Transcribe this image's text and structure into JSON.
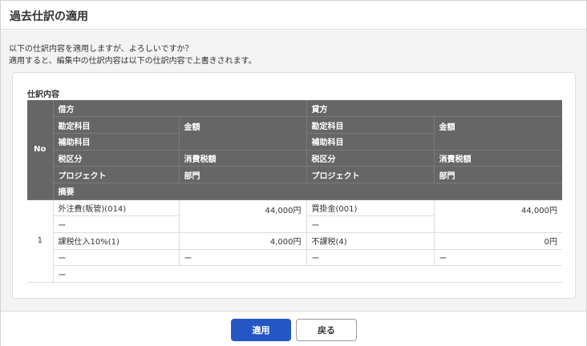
{
  "dialog": {
    "title": "過去仕訳の適用",
    "message_line1": "以下の仕訳内容を適用しますが、よろしいですか？",
    "message_line2": "適用すると、編集中の仕訳内容は以下の仕訳内容で上書きされます。"
  },
  "card": {
    "title": "仕訳内容"
  },
  "table_headers": {
    "no": "No",
    "debit": "借方",
    "credit": "貸方",
    "debit_account": "勘定科目",
    "debit_amount": "金額",
    "credit_account": "勘定科目",
    "credit_amount": "金額",
    "debit_sub_account": "補助科目",
    "credit_sub_account": "補助科目",
    "debit_tax_category": "税区分",
    "debit_tax_amount": "消費税額",
    "credit_tax_category": "税区分",
    "credit_tax_amount": "消費税額",
    "debit_project": "プロジェクト",
    "debit_department": "部門",
    "credit_project": "プロジェクト",
    "credit_department": "部門",
    "summary": "摘要"
  },
  "entry": {
    "no": "1",
    "debit_account": "外注費(販管)(014)",
    "debit_amount": "44,000円",
    "credit_account": "買掛金(001)",
    "credit_amount": "44,000円",
    "debit_sub_account": "ー",
    "credit_sub_account": "ー",
    "debit_tax_category": "課税仕入10%(1)",
    "debit_tax_amount": "4,000円",
    "credit_tax_category": "不課税(4)",
    "credit_tax_amount": "0円",
    "debit_project": "ー",
    "debit_department": "ー",
    "credit_project": "ー",
    "credit_department": "ー",
    "summary": "ー"
  },
  "buttons": {
    "apply": "適用",
    "back": "戻る"
  },
  "colors": {
    "primary": "#2457c5",
    "header_bg": "#666666"
  }
}
